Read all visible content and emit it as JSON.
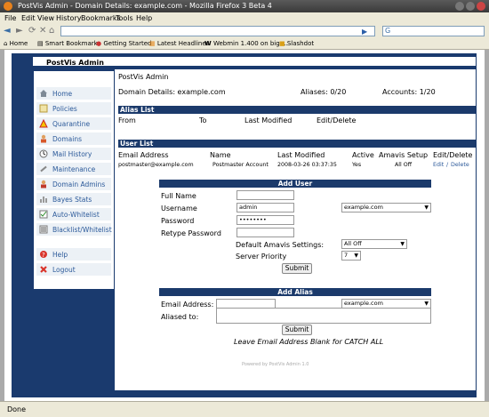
{
  "window": {
    "title": "PostVis Admin - Domain Details: example.com - Mozilla Firefox 3 Beta 4"
  },
  "menu": [
    "File",
    "Edit",
    "View",
    "History",
    "Bookmarks",
    "Tools",
    "Help"
  ],
  "nav": {
    "back": "◄",
    "forward": "►",
    "reload": "⟳",
    "stop": "✕",
    "home": "⌂",
    "search_engine": "G"
  },
  "bookmarks": [
    "Home",
    "Smart Bookmarks",
    "Getting Started",
    "Latest Headlines",
    "Webmin 1.400 on big-...",
    "Slashdot"
  ],
  "app": {
    "brand": "PostVis Admin"
  },
  "sidebar": {
    "items": [
      {
        "label": "Home",
        "icon": "home-icon"
      },
      {
        "label": "Policies",
        "icon": "policy-icon"
      },
      {
        "label": "Quarantine",
        "icon": "warning-icon"
      },
      {
        "label": "Domains",
        "icon": "user-icon"
      },
      {
        "label": "Mail History",
        "icon": "clock-icon"
      },
      {
        "label": "Maintenance",
        "icon": "tools-icon"
      },
      {
        "label": "Domain Admins",
        "icon": "admin-icon"
      },
      {
        "label": "Bayes Stats",
        "icon": "stats-icon"
      },
      {
        "label": "Auto-Whitelist",
        "icon": "checklist-icon"
      },
      {
        "label": "Blacklist/Whitelist",
        "icon": "list-icon"
      },
      {
        "label": "Help",
        "icon": "help-icon"
      },
      {
        "label": "Logout",
        "icon": "logout-icon"
      }
    ]
  },
  "main": {
    "app_title": "PostVis Admin",
    "domain_details_label": "Domain Details: example.com",
    "aliases": "Aliases: 0/20",
    "accounts": "Accounts: 1/20",
    "alias_list": {
      "title": "Alias List",
      "columns": [
        "From",
        "To",
        "Last Modified",
        "Edit/Delete"
      ]
    },
    "user_list": {
      "title": "User List",
      "columns": [
        "Email Address",
        "Name",
        "Last Modified",
        "Active",
        "Amavis Setup",
        "Edit/Delete"
      ],
      "row": {
        "email": "postmaster@example.com",
        "name": "Postmaster Account",
        "modified": "2008-03-26 03:37:35",
        "active": "Yes",
        "amavis": "All Off",
        "edit": "Edit",
        "sep": "/",
        "delete": "Delete"
      }
    },
    "add_user": {
      "title": "Add User",
      "full_name_label": "Full Name",
      "username_label": "Username",
      "username_value": "admin",
      "domain_value": "example.com",
      "password_label": "Password",
      "password_value": "••••••••",
      "retype_label": "Retype Password",
      "amavis_label": "Default Amavis Settings:",
      "amavis_value": "All Off",
      "priority_label": "Server Priority",
      "priority_value": "7",
      "submit": "Submit"
    },
    "add_alias": {
      "title": "Add Alias",
      "email_label": "Email Address:",
      "domain_value": "example.com",
      "aliased_label": "Aliased to:",
      "submit": "Submit",
      "note": "Leave Email Address Blank for CATCH ALL"
    },
    "footer": "Powered by PostVis Admin 1.0"
  },
  "status": "Done"
}
